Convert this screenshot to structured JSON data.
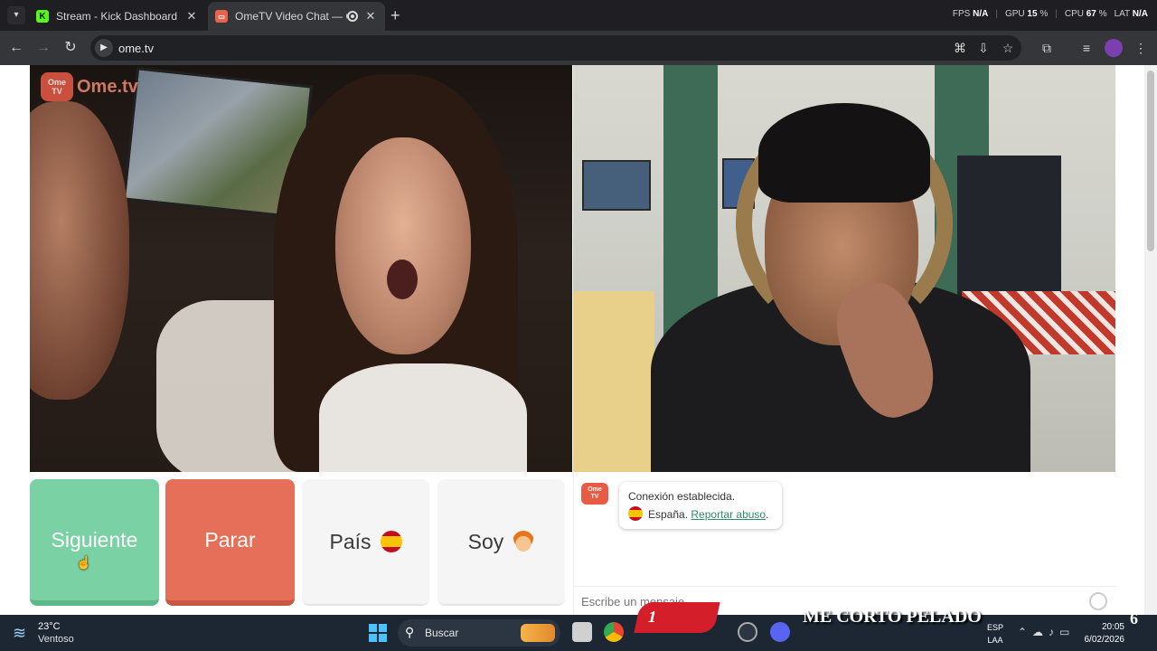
{
  "browser": {
    "tabs": [
      {
        "title": "Stream - Kick Dashboard",
        "icon": "kick-icon",
        "active": false
      },
      {
        "title": "OmeTV Video Chat — Ome",
        "icon": "ometv-icon",
        "active": true
      }
    ],
    "perf": {
      "fps_label": "FPS",
      "fps_value": "N/A",
      "gpu_label": "GPU",
      "gpu_value": "15",
      "gpu_unit": "%",
      "cpu_label": "CPU",
      "cpu_value": "67",
      "cpu_unit": "%",
      "lat_label": "LAT",
      "lat_value": "N/A"
    },
    "url": "ome.tv"
  },
  "page": {
    "logo": {
      "badge_line1": "Ome",
      "badge_line2": "TV",
      "text": "Ome.tv"
    },
    "buttons": {
      "next": "Siguiente",
      "stop": "Parar",
      "country": "País",
      "gender": "Soy"
    },
    "chat": {
      "status": "Conexión establecida.",
      "country": "España.",
      "report_link": "Reportar abuso",
      "report_suffix": ".",
      "input_placeholder": "Escribe un mensaje"
    },
    "accent_colors": {
      "next": "#7ad1a3",
      "stop": "#e56f58",
      "link": "#2c8a66",
      "brand": "#e85b45"
    }
  },
  "overlay": {
    "badge_number": "1",
    "banner_text": "ME CORTO PELADO",
    "corner_number": "6"
  },
  "taskbar": {
    "weather_temp": "23°C",
    "weather_desc": "Ventoso",
    "search_label": "Buscar",
    "lang_line1": "ESP",
    "lang_line2": "LAA",
    "time": "20:05",
    "date": "6/02/2026"
  }
}
